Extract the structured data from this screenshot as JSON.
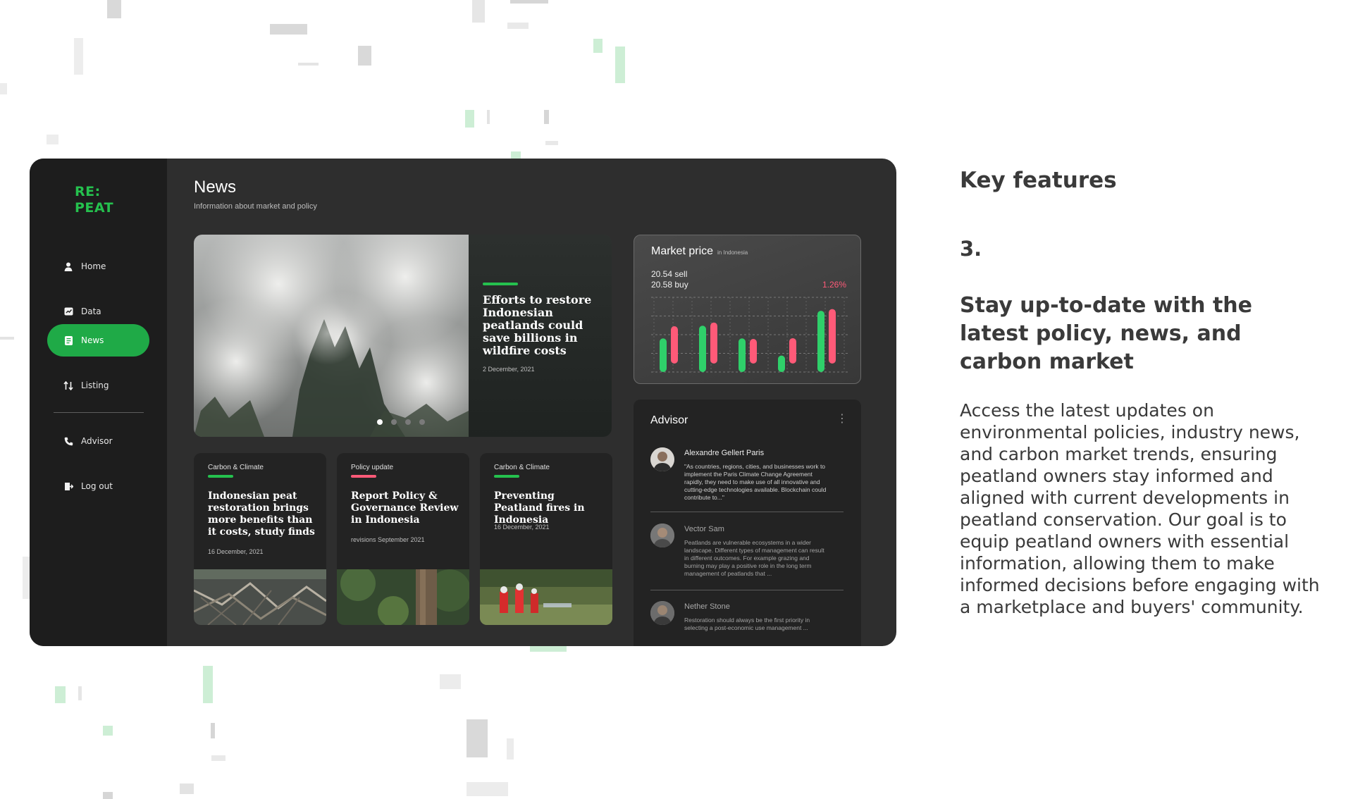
{
  "brand": {
    "line1": "RE:",
    "line2": "PEAT",
    "color": "#25c14e"
  },
  "sidebar": {
    "items": [
      {
        "label": "Home",
        "icon": "user-icon"
      },
      {
        "label": "Data",
        "icon": "chart-icon"
      },
      {
        "label": "News",
        "icon": "document-icon",
        "active": true
      },
      {
        "label": "Listing",
        "icon": "transfer-icon"
      },
      {
        "label": "Advisor",
        "icon": "phone-icon"
      },
      {
        "label": "Log out",
        "icon": "logout-icon"
      }
    ]
  },
  "page": {
    "title": "News",
    "subtitle": "Information about market and policy"
  },
  "hero": {
    "title": "Efforts to restore Indonesian peatlands could save billions in wildfire costs",
    "date": "2 December, 2021",
    "slide_count": 4,
    "active_slide": 1
  },
  "cards": [
    {
      "category": "Carbon & Climate",
      "accent": "#25c14e",
      "title": "Indonesian peat restoration brings more benefits than it costs, study finds",
      "date": "16 December, 2021"
    },
    {
      "category": "Policy update",
      "accent": "#ff5a78",
      "title": "Report Policy & Governance Review in Indonesia",
      "date": "revisions September 2021"
    },
    {
      "category": "Carbon & Climate",
      "accent": "#25c14e",
      "title": "Preventing Peatland fires in Indonesia",
      "date": "16 December, 2021"
    }
  ],
  "market": {
    "title": "Market price",
    "region": "in Indonesia",
    "sell": "20.54 sell",
    "buy": "20.58 buy",
    "change": "1.26%",
    "colors": {
      "up": "#2fd06a",
      "down": "#ff5a78"
    }
  },
  "chart_data": {
    "type": "bar",
    "series": [
      {
        "color": "#2fd06a",
        "values": [
          0.45,
          0.62,
          0.45,
          0.22,
          0.82
        ]
      },
      {
        "color": "#ff5a78",
        "values": [
          0.5,
          0.55,
          0.33,
          0.34,
          0.73
        ]
      }
    ],
    "grid": true,
    "ylim": [
      0,
      1
    ]
  },
  "advisor": {
    "title": "Advisor",
    "items": [
      {
        "name": "Alexandre Gellert Paris",
        "quote": "\"As countries, regions, cities, and businesses work to implement the Paris Climate Change Agreement rapidly, they need to make use of all innovative and cutting-edge technologies available. Blockchain could contribute to...\""
      },
      {
        "name": "Vector Sam",
        "quote": "Peatlands are vulnerable ecosystems in a wider landscape. Different types of management can result in different outcomes. For example grazing and burning may play a positive role in the long term management of peatlands that ..."
      },
      {
        "name": "Nether Stone",
        "quote": "Restoration should always be the first priority in selecting a post-economic use management ..."
      }
    ]
  },
  "features": {
    "heading": "Key features",
    "number": "3.",
    "title": "Stay up-to-date with the latest policy, news, and carbon market",
    "body": "Access the latest updates on environmental policies, industry news, and carbon market trends, ensuring peatland owners stay informed and aligned with current developments in peatland conservation. Our goal is to equip peatland owners with essential information, allowing them to make informed decisions before engaging with a marketplace and buyers' community."
  }
}
